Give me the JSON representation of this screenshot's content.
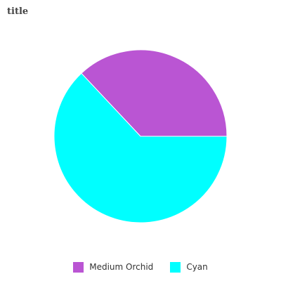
{
  "chart_data": {
    "type": "pie",
    "title": "title",
    "categories": [
      "Medium Orchid",
      "Cyan"
    ],
    "values": [
      37,
      63
    ],
    "colors": [
      "#ba55d3",
      "#00ffff"
    ],
    "legend_position": "bottom"
  }
}
